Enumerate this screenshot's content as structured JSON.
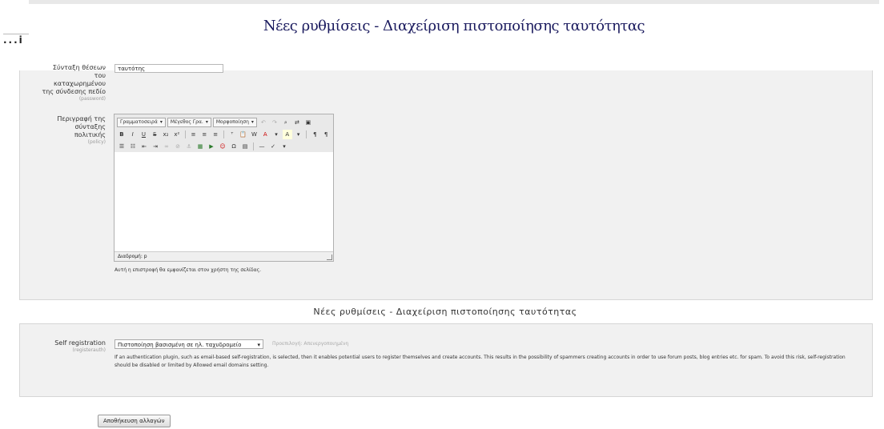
{
  "header": {
    "title": "Νέες ρυθμίσεις - Διαχείριση πιστοποίησης ταυτότητας",
    "side_tab": "...i"
  },
  "section1": {
    "field1": {
      "label": "Σύνταξη θέσεων του καταχωρημένου της σύνδεσης πεδίο",
      "sub": "(password)",
      "value": "ταυτότης"
    },
    "field2": {
      "label": "Περιγραφή της σύνταξης πολιτικής",
      "sub": "(policy)",
      "editor": {
        "font_family": "Γραμματοσειρά",
        "font_size": "Μέγεθος Γρα.",
        "format": "Μορφοποίηση",
        "status_path": "Διαδρομή: p"
      },
      "help": "Αυτή η επιστροφή θα εμφανίζεται στον χρήστη της σελίδας."
    }
  },
  "section2": {
    "title": "Νέες ρυθμίσεις - Διαχείριση πιστοποίησης ταυτότητας",
    "field": {
      "label": "Self registration",
      "sub": "(registerauth)",
      "selected": "Πιστοποίηση βασισμένη σε ηλ. ταχυδρομείο",
      "default_note": "Προεπιλογή: Απενεργοποιημένη",
      "description": "If an authentication plugin, such as email-based self-registration, is selected, then it enables potential users to register themselves and create accounts. This results in the possibility of spammers creating accounts in order to use forum posts, blog entries etc. for spam. To avoid this risk, self-registration should be disabled or limited by Allowed email domains setting."
    }
  },
  "footer": {
    "save_label": "Αποθήκευση αλλαγών"
  }
}
